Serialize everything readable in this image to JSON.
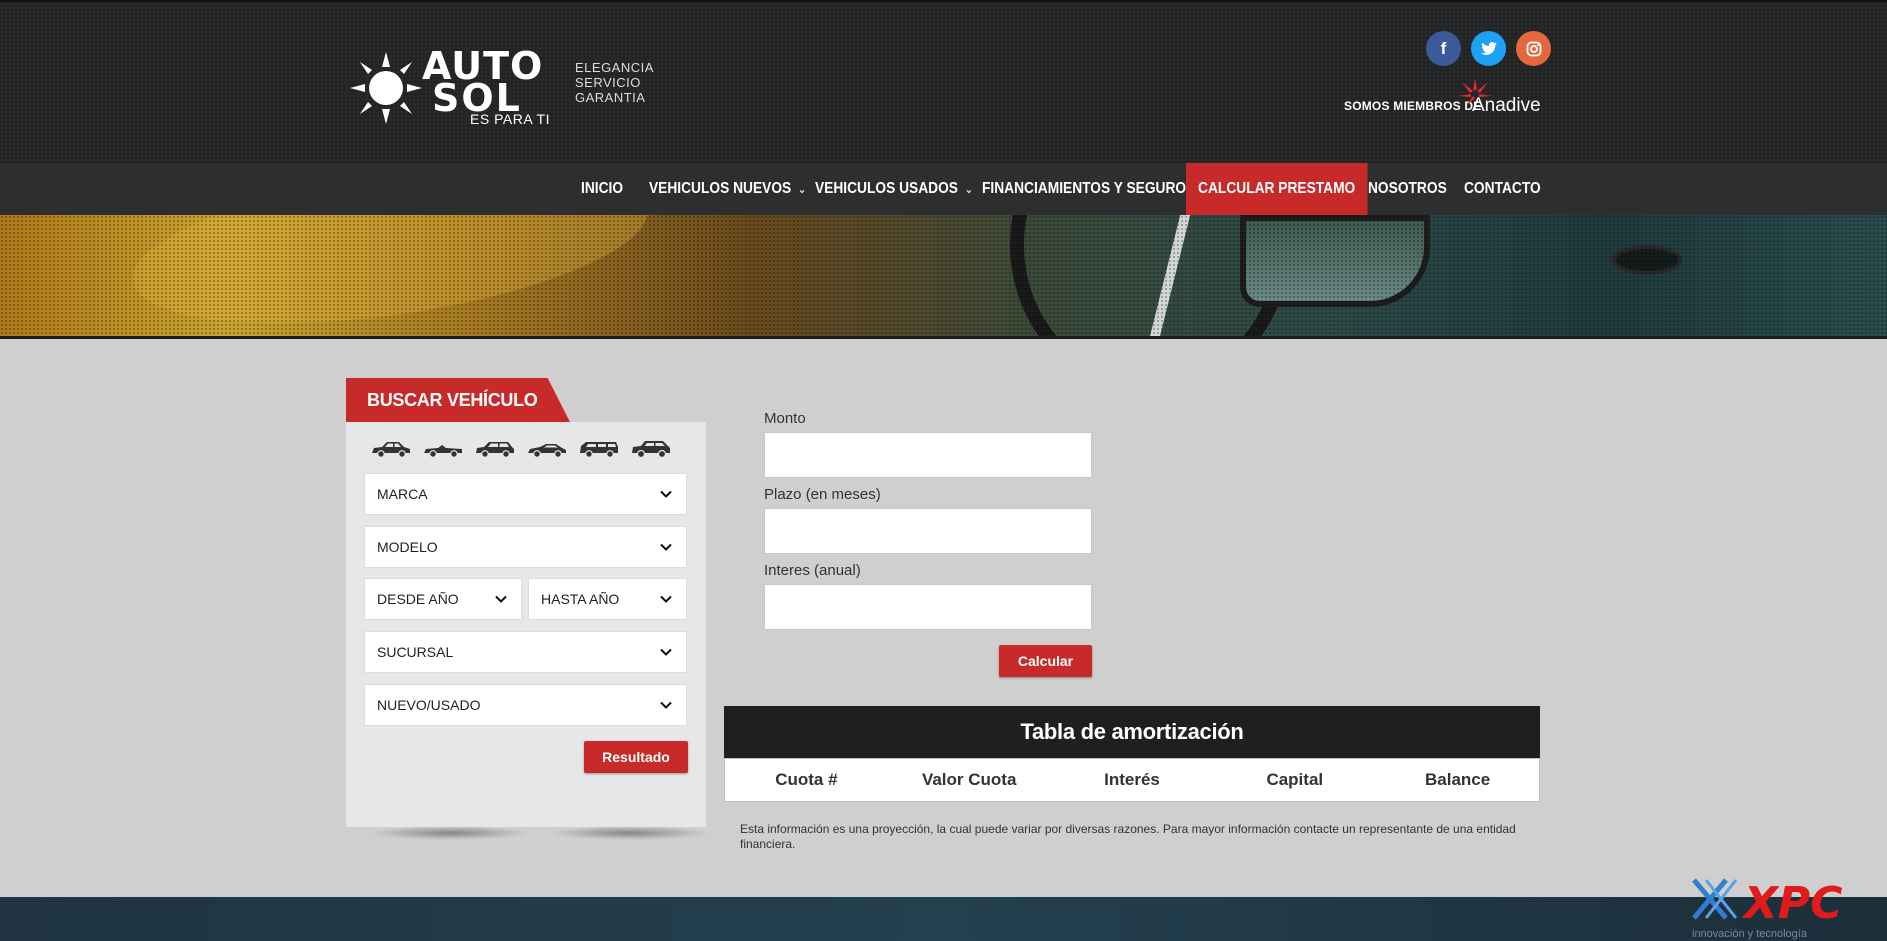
{
  "header": {
    "logo": {
      "auto": "AUTO",
      "sol": "SOL",
      "tagline": "ES PARA TI",
      "words": [
        "ELEGANCIA",
        "SERVICIO",
        "GARANTIA"
      ]
    },
    "social": [
      {
        "icon": "facebook-icon",
        "glyph": "f",
        "color": "#3b5a9a"
      },
      {
        "icon": "twitter-icon",
        "glyph": "t",
        "color": "#1da1f2"
      },
      {
        "icon": "instagram-icon",
        "glyph": "◎",
        "color": "#e4673f"
      }
    ],
    "members_text": "SOMOS MIEMBROS DE",
    "anadive_text": "Anadive"
  },
  "nav": {
    "items": [
      {
        "label": "INICIO",
        "dropdown": false,
        "active": false
      },
      {
        "label": "VEHICULOS NUEVOS",
        "dropdown": true,
        "active": false
      },
      {
        "label": "VEHICULOS USADOS",
        "dropdown": true,
        "active": false
      },
      {
        "label": "FINANCIAMIENTOS Y SEGUROS",
        "dropdown": false,
        "active": false
      },
      {
        "label": "CALCULAR PRESTAMO",
        "dropdown": false,
        "active": true
      },
      {
        "label": "NOSOTROS",
        "dropdown": false,
        "active": false
      },
      {
        "label": "CONTACTO",
        "dropdown": false,
        "active": false
      }
    ],
    "active_color": "#c82a2a"
  },
  "search": {
    "title": "BUSCAR VEHÍCULO",
    "vehicle_types": [
      "sedan-icon",
      "convertible-icon",
      "hatchback-icon",
      "coupe-icon",
      "van-icon",
      "suv-icon"
    ],
    "selects": {
      "marca": "MARCA",
      "modelo": "MODELO",
      "desde": "DESDE AÑO",
      "hasta": "HASTA AÑO",
      "sucursal": "SUCURSAL",
      "nuevo_usado": "NUEVO/USADO"
    },
    "result_button": "Resultado"
  },
  "calculator": {
    "monto_label": "Monto",
    "plazo_label": "Plazo (en meses)",
    "interes_label": "Interes (anual)",
    "monto_value": "",
    "plazo_value": "",
    "interes_value": "",
    "calc_button": "Calcular"
  },
  "amortization": {
    "title": "Tabla de amortización",
    "columns": [
      "Cuota #",
      "Valor Cuota",
      "Interés",
      "Capital",
      "Balance"
    ],
    "rows": []
  },
  "disclaimer": "Esta información es una proyección, la cual puede variar por diversas razones. Para mayor información contacte un representante de una entidad financiera.",
  "footer": {
    "xpc_logo": "XPC",
    "xpc_tagline": "innovación y tecnología"
  }
}
